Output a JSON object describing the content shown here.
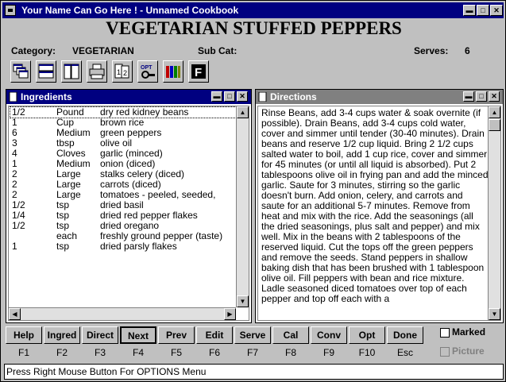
{
  "window": {
    "title": "Your Name Can Go Here ! - Unnamed Cookbook",
    "titlebar_color": "#000080"
  },
  "recipe": {
    "title": "VEGETARIAN STUFFED PEPPERS",
    "category_label": "Category:",
    "category": "VEGETARIAN",
    "subcat_label": "Sub Cat:",
    "subcat": "",
    "serves_label": "Serves:",
    "serves": "6"
  },
  "toolbar": {
    "icons": [
      "cascade-icon",
      "tile-horizontal-icon",
      "tile-vertical-icon",
      "print-icon",
      "number-icon",
      "options-icon",
      "crayons-icon",
      "font-icon"
    ],
    "opt_label": "OPT"
  },
  "ingredients_pane": {
    "title": "Ingredients",
    "title_color": "#000080",
    "rows": [
      [
        "1/2",
        "Pound",
        "dry red kidney beans"
      ],
      [
        "1",
        "Cup",
        "brown rice"
      ],
      [
        "6",
        "Medium",
        "green peppers"
      ],
      [
        "3",
        "tbsp",
        "olive oil"
      ],
      [
        "4",
        "Cloves",
        "garlic (minced)"
      ],
      [
        "1",
        "Medium",
        "onion (diced)"
      ],
      [
        "2",
        "Large",
        "stalks celery (diced)"
      ],
      [
        "2",
        "Large",
        "carrots (diced)"
      ],
      [
        "2",
        "Large",
        "tomatoes - peeled, seeded,"
      ],
      [
        "1/2",
        "tsp",
        "dried basil"
      ],
      [
        "1/4",
        "tsp",
        "dried red pepper flakes"
      ],
      [
        "1/2",
        "tsp",
        "dried oregano"
      ],
      [
        "",
        "each",
        "freshly ground pepper (taste)"
      ],
      [
        "1",
        "tsp",
        "dried parsly flakes"
      ]
    ]
  },
  "directions_pane": {
    "title": "Directions",
    "title_color": "#808080",
    "text": "Rinse Beans, add 3-4 cups water & soak overnite (if possible). Drain Beans, add 3-4 cups cold water, cover and simmer until tender (30-40 minutes).  Drain beans and reserve 1/2 cup liquid.   Bring 2 1/2 cups salted water to boil, add 1 cup rice, cover and simmer for 45 minutes (or until all liquid is absorbed).  Put 2 tablespoons olive oil in frying pan and add the minced garlic. Saute for 3 minutes, stirring so the garlic doesn't burn.  Add onion, celery, and carrots and saute for an additional 5-7 minutes.  Remove from heat and mix with the rice.  Add the seasonings (all the dried seasonings, plus salt and pepper) and mix well.  Mix in the beans with 2 tablespoons of the reserved liquid.  Cut the tops off the green peppers and remove the seeds.  Stand peppers in shallow baking dish that has been brushed with 1 tablespoon olive oil. Fill peppers with bean and rice mixture.   Ladle seasoned diced tomatoes over top of each pepper and top off each with a"
  },
  "function_buttons": [
    {
      "label": "Help",
      "key": "F1"
    },
    {
      "label": "Ingred",
      "key": "F2"
    },
    {
      "label": "Direct",
      "key": "F3"
    },
    {
      "label": "Next",
      "key": "F4"
    },
    {
      "label": "Prev",
      "key": "F5"
    },
    {
      "label": "Edit",
      "key": "F6"
    },
    {
      "label": "Serve",
      "key": "F7"
    },
    {
      "label": "Cal",
      "key": "F8"
    },
    {
      "label": "Conv",
      "key": "F9"
    },
    {
      "label": "Opt",
      "key": "F10"
    },
    {
      "label": "Done",
      "key": "Esc"
    }
  ],
  "checkboxes": {
    "marked": "Marked",
    "picture": "Picture"
  },
  "status": "Press Right Mouse Button For OPTIONS Menu"
}
